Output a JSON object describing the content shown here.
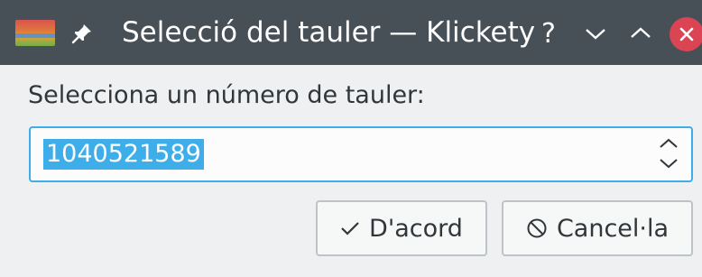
{
  "window": {
    "title": "Selecció del tauler — Klickety",
    "help_glyph": "?"
  },
  "dialog": {
    "prompt": "Selecciona un número de tauler:",
    "board_number": "1040521589"
  },
  "buttons": {
    "ok_label": "D'acord",
    "cancel_label": "Cancel·la"
  },
  "colors": {
    "titlebar": "#475057",
    "selection": "#3daee9",
    "close": "#da4453",
    "window_bg": "#eff0f1"
  }
}
